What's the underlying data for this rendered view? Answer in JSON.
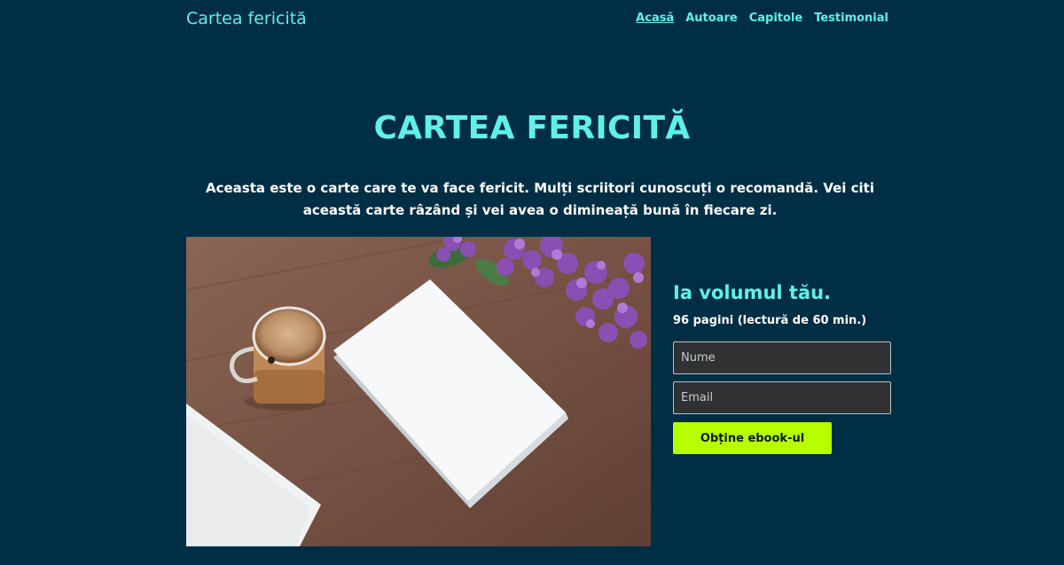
{
  "header": {
    "brand": "Cartea fericită",
    "nav": [
      {
        "label": "Acasă",
        "active": true
      },
      {
        "label": "Autoare",
        "active": false
      },
      {
        "label": "Capitole",
        "active": false
      },
      {
        "label": "Testimonial",
        "active": false
      }
    ]
  },
  "hero": {
    "title": "CARTEA FERICITĂ",
    "description": "Aceasta este o carte care te va face fericit. Mulți scriitori cunoscuți o recomandă. Vei citi această carte râzând și vei avea o dimineață bună în fiecare zi."
  },
  "signup": {
    "heading": "Ia volumul tău.",
    "meta": "96 pagini (lectură de 60 min.)",
    "name_placeholder": "Nume",
    "email_placeholder": "Email",
    "button_label": "Obține ebook-ul"
  },
  "colors": {
    "background": "#002e45",
    "accent": "#5ff0ea",
    "cta": "#b7ff00"
  },
  "photo": {
    "subject": "coffee-book-lilac-photo"
  }
}
